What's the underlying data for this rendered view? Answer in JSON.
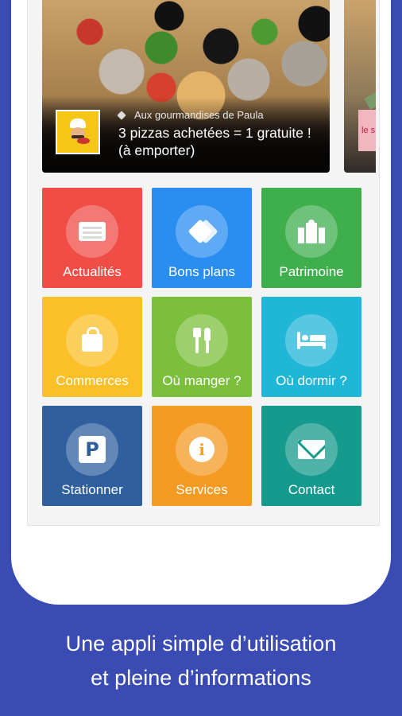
{
  "banner": {
    "category": "Aux gourmandises de Paula",
    "title": "3 pizzas achetées = 1 gratuite ! (à emporter)",
    "side_card_label": "le s"
  },
  "tiles": [
    {
      "label": "Actualités",
      "icon": "newspaper-icon",
      "color": "#f04d46"
    },
    {
      "label": "Bons plans",
      "icon": "tags-icon",
      "color": "#2a8ef0"
    },
    {
      "label": "Patrimoine",
      "icon": "building-icon",
      "color": "#3fae4d"
    },
    {
      "label": "Commerces",
      "icon": "shopping-bag-icon",
      "color": "#fbbf27"
    },
    {
      "label": "Où manger ?",
      "icon": "cutlery-icon",
      "color": "#7cbf3d"
    },
    {
      "label": "Où dormir ?",
      "icon": "bed-icon",
      "color": "#20b6d8"
    },
    {
      "label": "Stationner",
      "icon": "parking-icon",
      "color": "#2f5f9e"
    },
    {
      "label": "Services",
      "icon": "info-icon",
      "color": "#f59a22"
    },
    {
      "label": "Contact",
      "icon": "envelope-icon",
      "color": "#169a8d"
    }
  ],
  "icons_text": {
    "parking": "P",
    "info": "i"
  },
  "footer": {
    "line1": "Une appli simple d’utilisation",
    "line2": "et pleine d’informations"
  }
}
